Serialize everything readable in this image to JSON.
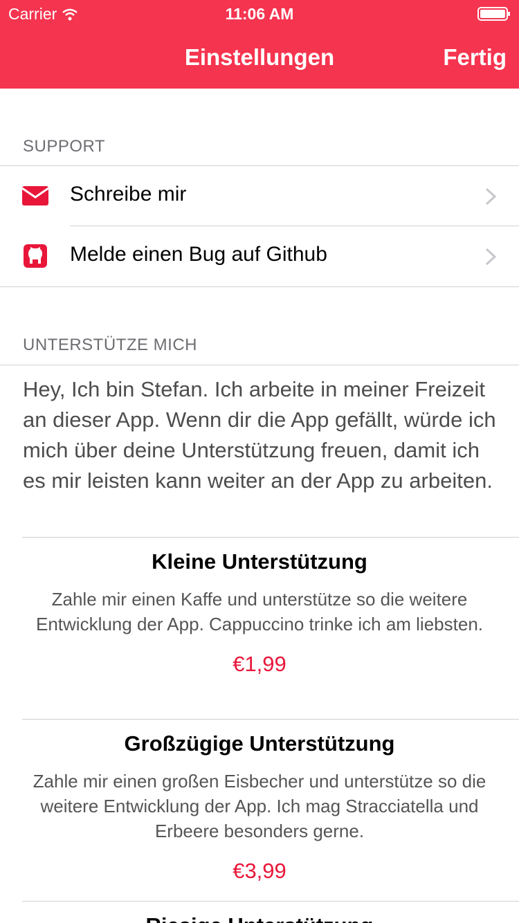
{
  "status_bar": {
    "carrier": "Carrier",
    "time": "11:06 AM"
  },
  "nav": {
    "title": "Einstellungen",
    "done": "Fertig"
  },
  "support": {
    "title": "SUPPORT",
    "items": [
      {
        "label": "Schreibe mir",
        "icon": "mail-icon"
      },
      {
        "label": "Melde einen Bug auf Github",
        "icon": "github-icon"
      }
    ]
  },
  "donate": {
    "title": "UNTERSTÜTZE MICH",
    "intro": "Hey, Ich bin Stefan. Ich arbeite in meiner Freizeit an dieser App. Wenn dir die App gefällt, würde ich mich über deine Unterstützung freuen, damit ich es mir leisten kann weiter an der App zu arbeiten.",
    "tiers": [
      {
        "title": "Kleine Unterstützung",
        "description": "Zahle mir einen Kaffe und unterstütze so die weitere Entwicklung der App. Cappuccino trinke ich am liebsten.",
        "price": "€1,99"
      },
      {
        "title": "Großzügige Unterstützung",
        "description": "Zahle mir einen großen Eisbecher und unterstütze so die weitere Entwicklung der App. Ich mag Stracciatella und Erbeere besonders gerne.",
        "price": "€3,99"
      },
      {
        "title": "Riesige Unterstützung",
        "description": "",
        "price": ""
      }
    ]
  },
  "colors": {
    "accent": "#f5344f",
    "price": "#e8173a"
  }
}
